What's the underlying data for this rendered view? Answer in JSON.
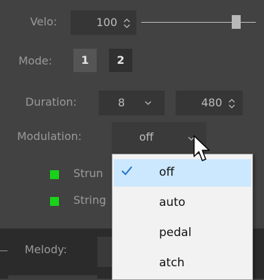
{
  "velo": {
    "label": "Velo:",
    "value": "100",
    "slider_level": 0.86
  },
  "mode": {
    "label": "Mode:",
    "options": [
      "1",
      "2"
    ],
    "selected": "1"
  },
  "duration": {
    "label": "Duration:",
    "note_value": "8",
    "ticks_value": "480"
  },
  "modulation": {
    "label": "Modulation:",
    "value": "off"
  },
  "checkboxes": [
    {
      "label": "Strum",
      "checked": true,
      "visible_text": "Strun"
    },
    {
      "label": "String",
      "checked": true,
      "visible_text": "String"
    }
  ],
  "melody": {
    "label": "Melody:"
  },
  "dropdown_menu": {
    "items": [
      "off",
      "auto",
      "pedal",
      "atch"
    ],
    "selected": "off"
  },
  "colors": {
    "checkbox_green": "#18d318",
    "menu_highlight": "#cce8ff",
    "check_blue": "#1e73c8"
  },
  "icons": {
    "spinner": "chevron-up-down-icon",
    "dropdown": "chevron-down-icon",
    "check": "check-icon",
    "cursor": "mouse-pointer-icon"
  }
}
